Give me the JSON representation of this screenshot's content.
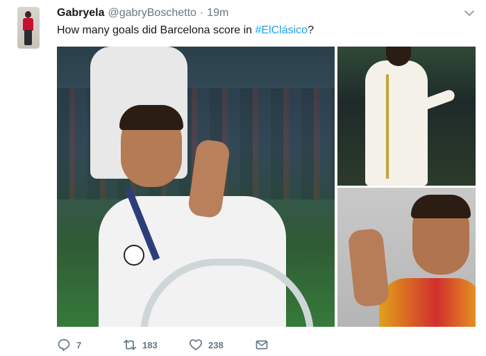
{
  "tweet": {
    "author_name": "Gabryela",
    "author_handle": "@gabryBoschetto",
    "separator": "·",
    "time": "19m",
    "text_prefix": "How many goals did Barcelona score in ",
    "hashtag": "#ElClásico",
    "text_suffix": "?"
  },
  "actions": {
    "reply_count": "7",
    "retweet_count": "183",
    "like_count": "238"
  },
  "icons": {
    "menu": "chevron-down-icon",
    "reply": "reply-icon",
    "retweet": "retweet-icon",
    "like": "heart-icon",
    "dm": "envelope-icon"
  },
  "colors": {
    "link": "#1da1f2",
    "muted": "#657786",
    "text": "#14171a"
  }
}
